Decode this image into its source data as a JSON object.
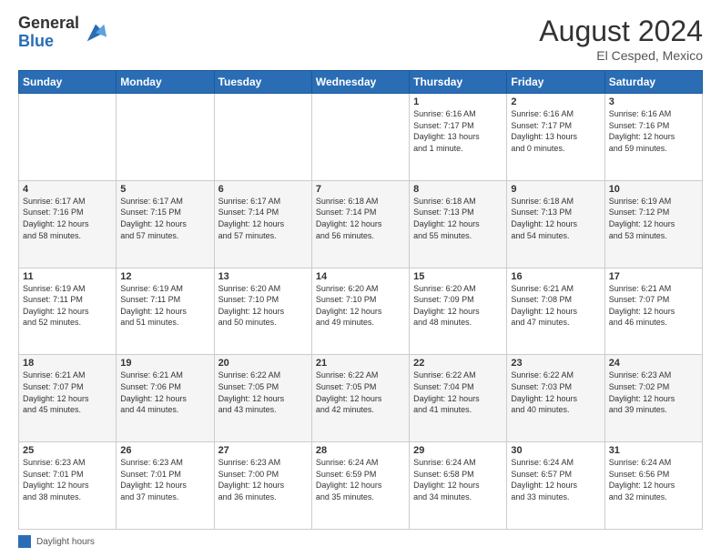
{
  "header": {
    "logo_general": "General",
    "logo_blue": "Blue",
    "month_year": "August 2024",
    "location": "El Cesped, Mexico"
  },
  "footer": {
    "label": "Daylight hours"
  },
  "days_of_week": [
    "Sunday",
    "Monday",
    "Tuesday",
    "Wednesday",
    "Thursday",
    "Friday",
    "Saturday"
  ],
  "weeks": [
    [
      {
        "day": "",
        "info": ""
      },
      {
        "day": "",
        "info": ""
      },
      {
        "day": "",
        "info": ""
      },
      {
        "day": "",
        "info": ""
      },
      {
        "day": "1",
        "info": "Sunrise: 6:16 AM\nSunset: 7:17 PM\nDaylight: 13 hours\nand 1 minute."
      },
      {
        "day": "2",
        "info": "Sunrise: 6:16 AM\nSunset: 7:17 PM\nDaylight: 13 hours\nand 0 minutes."
      },
      {
        "day": "3",
        "info": "Sunrise: 6:16 AM\nSunset: 7:16 PM\nDaylight: 12 hours\nand 59 minutes."
      }
    ],
    [
      {
        "day": "4",
        "info": "Sunrise: 6:17 AM\nSunset: 7:16 PM\nDaylight: 12 hours\nand 58 minutes."
      },
      {
        "day": "5",
        "info": "Sunrise: 6:17 AM\nSunset: 7:15 PM\nDaylight: 12 hours\nand 57 minutes."
      },
      {
        "day": "6",
        "info": "Sunrise: 6:17 AM\nSunset: 7:14 PM\nDaylight: 12 hours\nand 57 minutes."
      },
      {
        "day": "7",
        "info": "Sunrise: 6:18 AM\nSunset: 7:14 PM\nDaylight: 12 hours\nand 56 minutes."
      },
      {
        "day": "8",
        "info": "Sunrise: 6:18 AM\nSunset: 7:13 PM\nDaylight: 12 hours\nand 55 minutes."
      },
      {
        "day": "9",
        "info": "Sunrise: 6:18 AM\nSunset: 7:13 PM\nDaylight: 12 hours\nand 54 minutes."
      },
      {
        "day": "10",
        "info": "Sunrise: 6:19 AM\nSunset: 7:12 PM\nDaylight: 12 hours\nand 53 minutes."
      }
    ],
    [
      {
        "day": "11",
        "info": "Sunrise: 6:19 AM\nSunset: 7:11 PM\nDaylight: 12 hours\nand 52 minutes."
      },
      {
        "day": "12",
        "info": "Sunrise: 6:19 AM\nSunset: 7:11 PM\nDaylight: 12 hours\nand 51 minutes."
      },
      {
        "day": "13",
        "info": "Sunrise: 6:20 AM\nSunset: 7:10 PM\nDaylight: 12 hours\nand 50 minutes."
      },
      {
        "day": "14",
        "info": "Sunrise: 6:20 AM\nSunset: 7:10 PM\nDaylight: 12 hours\nand 49 minutes."
      },
      {
        "day": "15",
        "info": "Sunrise: 6:20 AM\nSunset: 7:09 PM\nDaylight: 12 hours\nand 48 minutes."
      },
      {
        "day": "16",
        "info": "Sunrise: 6:21 AM\nSunset: 7:08 PM\nDaylight: 12 hours\nand 47 minutes."
      },
      {
        "day": "17",
        "info": "Sunrise: 6:21 AM\nSunset: 7:07 PM\nDaylight: 12 hours\nand 46 minutes."
      }
    ],
    [
      {
        "day": "18",
        "info": "Sunrise: 6:21 AM\nSunset: 7:07 PM\nDaylight: 12 hours\nand 45 minutes."
      },
      {
        "day": "19",
        "info": "Sunrise: 6:21 AM\nSunset: 7:06 PM\nDaylight: 12 hours\nand 44 minutes."
      },
      {
        "day": "20",
        "info": "Sunrise: 6:22 AM\nSunset: 7:05 PM\nDaylight: 12 hours\nand 43 minutes."
      },
      {
        "day": "21",
        "info": "Sunrise: 6:22 AM\nSunset: 7:05 PM\nDaylight: 12 hours\nand 42 minutes."
      },
      {
        "day": "22",
        "info": "Sunrise: 6:22 AM\nSunset: 7:04 PM\nDaylight: 12 hours\nand 41 minutes."
      },
      {
        "day": "23",
        "info": "Sunrise: 6:22 AM\nSunset: 7:03 PM\nDaylight: 12 hours\nand 40 minutes."
      },
      {
        "day": "24",
        "info": "Sunrise: 6:23 AM\nSunset: 7:02 PM\nDaylight: 12 hours\nand 39 minutes."
      }
    ],
    [
      {
        "day": "25",
        "info": "Sunrise: 6:23 AM\nSunset: 7:01 PM\nDaylight: 12 hours\nand 38 minutes."
      },
      {
        "day": "26",
        "info": "Sunrise: 6:23 AM\nSunset: 7:01 PM\nDaylight: 12 hours\nand 37 minutes."
      },
      {
        "day": "27",
        "info": "Sunrise: 6:23 AM\nSunset: 7:00 PM\nDaylight: 12 hours\nand 36 minutes."
      },
      {
        "day": "28",
        "info": "Sunrise: 6:24 AM\nSunset: 6:59 PM\nDaylight: 12 hours\nand 35 minutes."
      },
      {
        "day": "29",
        "info": "Sunrise: 6:24 AM\nSunset: 6:58 PM\nDaylight: 12 hours\nand 34 minutes."
      },
      {
        "day": "30",
        "info": "Sunrise: 6:24 AM\nSunset: 6:57 PM\nDaylight: 12 hours\nand 33 minutes."
      },
      {
        "day": "31",
        "info": "Sunrise: 6:24 AM\nSunset: 6:56 PM\nDaylight: 12 hours\nand 32 minutes."
      }
    ]
  ]
}
